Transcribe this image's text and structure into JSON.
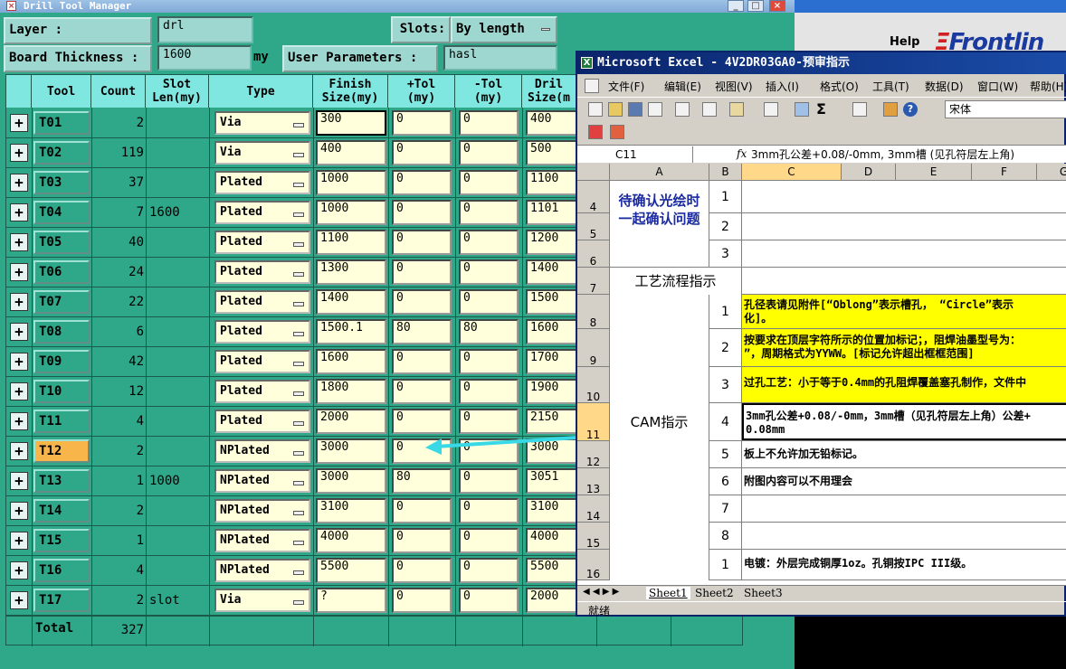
{
  "dtm": {
    "title": "Drill Tool Manager",
    "layer_label": "Layer          :",
    "layer_value": "drl",
    "slots_label": "Slots:",
    "slots_value": "By length",
    "board_thickness_label": "Board Thickness :",
    "board_thickness_value": "1600",
    "board_thickness_unit": "my",
    "user_params_label": "User Parameters :",
    "user_params_value": "hasl",
    "headers": {
      "tool": "Tool",
      "count": "Count",
      "slot_len": "Slot\nLen(my)",
      "type": "Type",
      "finish_size": "Finish\nSize(my)",
      "plus_tol": "+Tol\n(my)",
      "minus_tol": "-Tol\n(my)",
      "drill_size": "Dril\nSize(m"
    },
    "rows": [
      {
        "tool": "T01",
        "count": "2",
        "slot": "",
        "type": "Via",
        "finish": "300",
        "ptol": "0",
        "mtol": "0",
        "drill": "400"
      },
      {
        "tool": "T02",
        "count": "119",
        "slot": "",
        "type": "Via",
        "finish": "400",
        "ptol": "0",
        "mtol": "0",
        "drill": "500"
      },
      {
        "tool": "T03",
        "count": "37",
        "slot": "",
        "type": "Plated",
        "finish": "1000",
        "ptol": "0",
        "mtol": "0",
        "drill": "1100"
      },
      {
        "tool": "T04",
        "count": "7",
        "slot": "1600",
        "type": "Plated",
        "finish": "1000",
        "ptol": "0",
        "mtol": "0",
        "drill": "1101"
      },
      {
        "tool": "T05",
        "count": "40",
        "slot": "",
        "type": "Plated",
        "finish": "1100",
        "ptol": "0",
        "mtol": "0",
        "drill": "1200"
      },
      {
        "tool": "T06",
        "count": "24",
        "slot": "",
        "type": "Plated",
        "finish": "1300",
        "ptol": "0",
        "mtol": "0",
        "drill": "1400"
      },
      {
        "tool": "T07",
        "count": "22",
        "slot": "",
        "type": "Plated",
        "finish": "1400",
        "ptol": "0",
        "mtol": "0",
        "drill": "1500"
      },
      {
        "tool": "T08",
        "count": "6",
        "slot": "",
        "type": "Plated",
        "finish": "1500.1",
        "ptol": "80",
        "mtol": "80",
        "drill": "1600"
      },
      {
        "tool": "T09",
        "count": "42",
        "slot": "",
        "type": "Plated",
        "finish": "1600",
        "ptol": "0",
        "mtol": "0",
        "drill": "1700"
      },
      {
        "tool": "T10",
        "count": "12",
        "slot": "",
        "type": "Plated",
        "finish": "1800",
        "ptol": "0",
        "mtol": "0",
        "drill": "1900"
      },
      {
        "tool": "T11",
        "count": "4",
        "slot": "",
        "type": "Plated",
        "finish": "2000",
        "ptol": "0",
        "mtol": "0",
        "drill": "2150"
      },
      {
        "tool": "T12",
        "count": "2",
        "slot": "",
        "type": "NPlated",
        "finish": "3000",
        "ptol": "0",
        "mtol": "0",
        "drill": "3000"
      },
      {
        "tool": "T13",
        "count": "1",
        "slot": "1000",
        "type": "NPlated",
        "finish": "3000",
        "ptol": "80",
        "mtol": "0",
        "drill": "3051"
      },
      {
        "tool": "T14",
        "count": "2",
        "slot": "",
        "type": "NPlated",
        "finish": "3100",
        "ptol": "0",
        "mtol": "0",
        "drill": "3100"
      },
      {
        "tool": "T15",
        "count": "1",
        "slot": "",
        "type": "NPlated",
        "finish": "4000",
        "ptol": "0",
        "mtol": "0",
        "drill": "4000"
      },
      {
        "tool": "T16",
        "count": "4",
        "slot": "",
        "type": "NPlated",
        "finish": "5500",
        "ptol": "0",
        "mtol": "0",
        "drill": "5500"
      },
      {
        "tool": "T17",
        "count": "2",
        "slot": "slot",
        "type": "Via",
        "finish": "?",
        "ptol": "0",
        "mtol": "0",
        "drill": "2000"
      }
    ],
    "total_label": "Total",
    "total_value": "327",
    "selected_tool": "T12",
    "selected_color": "#f8b64a",
    "arrow_color": "#39d8e6"
  },
  "background_app": {
    "help_label": "Help",
    "brand": "Frontlin"
  },
  "excel": {
    "title": "Microsoft Excel - 4V2DR03GA0-预审指示",
    "menu": [
      "文件(F)",
      "编辑(E)",
      "视图(V)",
      "插入(I)",
      "格式(O)",
      "工具(T)",
      "数据(D)",
      "窗口(W)",
      "帮助(H)"
    ],
    "font_name": "宋体",
    "name_box": "C11",
    "fx": "fx",
    "formula": "3mm孔公差+0.08/-0mm, 3mm槽 (见孔符层左上角)",
    "columns": [
      "A",
      "B",
      "C",
      "D",
      "E",
      "F",
      "G"
    ],
    "rows": {
      "r4": "4",
      "r5": "5",
      "r6": "6",
      "r7": "7",
      "r8": "8",
      "r9": "9",
      "r10": "10",
      "r11": "11",
      "r12": "12",
      "r13": "13",
      "r14": "14",
      "r15": "15",
      "r16": "16"
    },
    "a_pending": "待确认光绘时\n一起确认问题",
    "a_process": "工艺流程指示",
    "a_cam": "CAM指示",
    "b_nums": [
      "1",
      "2",
      "3",
      "1",
      "2",
      "3",
      "4",
      "5",
      "6",
      "7",
      "8",
      "1"
    ],
    "c8": "孔径表请见附件[“Oblong”表示槽孔， “Circle”表示\n化]。",
    "c9": "按要求在顶层字符所示的位置加标记；，阻焊油墨型号为：\n”，周期格式为YYWW。[标记允许超出框框范围]",
    "c10": "过孔工艺：小于等于0.4mm的孔阻焊覆盖塞孔制作，文件中",
    "c11": "3mm孔公差+0.08/-0mm，3mm槽（见孔符层左上角）公差+\n0.08mm",
    "c12": "板上不允许加无铅标记。",
    "c13": "附图内容可以不用理会",
    "c16": "电镀：外层完成铜厚1oz。孔铜按IPC III级。",
    "sheets": [
      "Sheet1",
      "Sheet2",
      "Sheet3"
    ],
    "status": "就绪",
    "highlight_color": "#ffff00"
  }
}
